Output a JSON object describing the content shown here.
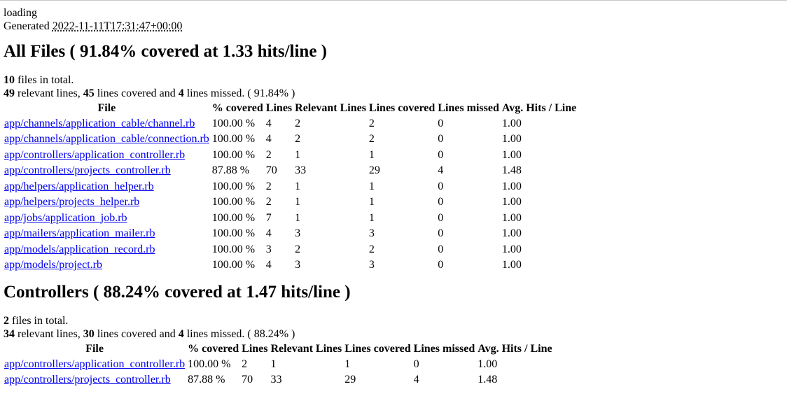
{
  "loading_alt": "loading",
  "generated": {
    "prefix": "Generated ",
    "timestamp": "2022-11-11T17:31:47+00:00"
  },
  "groups": [
    {
      "title": "All Files ( 91.84% covered at 1.33 hits/line )",
      "summary": {
        "files_count": "10",
        "files_text": " files in total.",
        "relevant": "49",
        "relevant_text": " relevant lines, ",
        "covered": "45",
        "covered_text": " lines covered and ",
        "missed": "4",
        "missed_text": " lines missed. ( 91.84% )"
      },
      "headers": [
        "File",
        "% covered",
        "Lines",
        "Relevant Lines",
        "Lines covered",
        "Lines missed",
        "Avg. Hits / Line"
      ],
      "rows": [
        {
          "file": "app/channels/application_cable/channel.rb",
          "covered": "100.00 %",
          "lines": "4",
          "relevant": "2",
          "lines_covered": "2",
          "missed": "0",
          "avg": "1.00"
        },
        {
          "file": "app/channels/application_cable/connection.rb",
          "covered": "100.00 %",
          "lines": "4",
          "relevant": "2",
          "lines_covered": "2",
          "missed": "0",
          "avg": "1.00"
        },
        {
          "file": "app/controllers/application_controller.rb",
          "covered": "100.00 %",
          "lines": "2",
          "relevant": "1",
          "lines_covered": "1",
          "missed": "0",
          "avg": "1.00"
        },
        {
          "file": "app/controllers/projects_controller.rb",
          "covered": "87.88 %",
          "lines": "70",
          "relevant": "33",
          "lines_covered": "29",
          "missed": "4",
          "avg": "1.48"
        },
        {
          "file": "app/helpers/application_helper.rb",
          "covered": "100.00 %",
          "lines": "2",
          "relevant": "1",
          "lines_covered": "1",
          "missed": "0",
          "avg": "1.00"
        },
        {
          "file": "app/helpers/projects_helper.rb",
          "covered": "100.00 %",
          "lines": "2",
          "relevant": "1",
          "lines_covered": "1",
          "missed": "0",
          "avg": "1.00"
        },
        {
          "file": "app/jobs/application_job.rb",
          "covered": "100.00 %",
          "lines": "7",
          "relevant": "1",
          "lines_covered": "1",
          "missed": "0",
          "avg": "1.00"
        },
        {
          "file": "app/mailers/application_mailer.rb",
          "covered": "100.00 %",
          "lines": "4",
          "relevant": "3",
          "lines_covered": "3",
          "missed": "0",
          "avg": "1.00"
        },
        {
          "file": "app/models/application_record.rb",
          "covered": "100.00 %",
          "lines": "3",
          "relevant": "2",
          "lines_covered": "2",
          "missed": "0",
          "avg": "1.00"
        },
        {
          "file": "app/models/project.rb",
          "covered": "100.00 %",
          "lines": "4",
          "relevant": "3",
          "lines_covered": "3",
          "missed": "0",
          "avg": "1.00"
        }
      ]
    },
    {
      "title": "Controllers ( 88.24% covered at 1.47 hits/line )",
      "summary": {
        "files_count": "2",
        "files_text": " files in total.",
        "relevant": "34",
        "relevant_text": " relevant lines, ",
        "covered": "30",
        "covered_text": " lines covered and ",
        "missed": "4",
        "missed_text": " lines missed. ( 88.24% )"
      },
      "headers": [
        "File",
        "% covered",
        "Lines",
        "Relevant Lines",
        "Lines covered",
        "Lines missed",
        "Avg. Hits / Line"
      ],
      "rows": [
        {
          "file": "app/controllers/application_controller.rb",
          "covered": "100.00 %",
          "lines": "2",
          "relevant": "1",
          "lines_covered": "1",
          "missed": "0",
          "avg": "1.00"
        },
        {
          "file": "app/controllers/projects_controller.rb",
          "covered": "87.88 %",
          "lines": "70",
          "relevant": "33",
          "lines_covered": "29",
          "missed": "4",
          "avg": "1.48"
        }
      ]
    }
  ],
  "colors": {
    "link": "#0000ee",
    "text": "#000000",
    "background": "#ffffff"
  }
}
